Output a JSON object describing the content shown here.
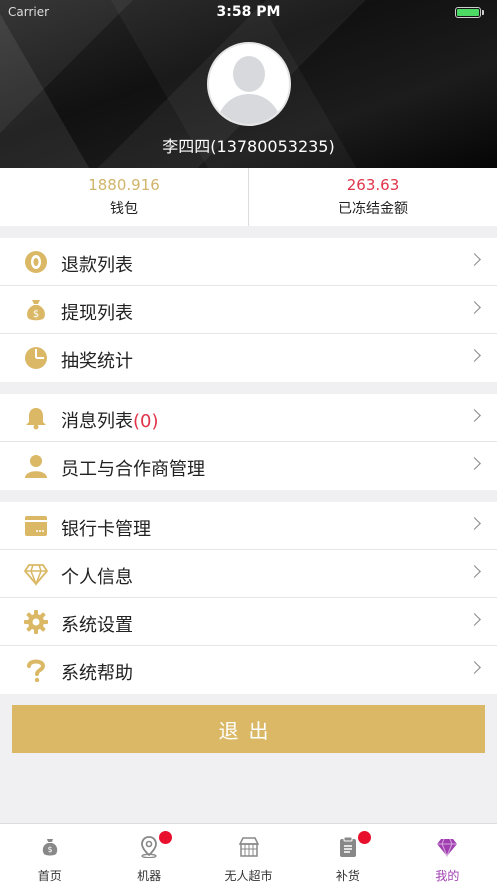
{
  "status_bar": {
    "carrier": "Carrier",
    "time": "3:58 PM"
  },
  "profile": {
    "name": "李四四(13780053235)"
  },
  "stats": [
    {
      "value": "1880.916",
      "label": "钱包",
      "color": "#d0b46a"
    },
    {
      "value": "263.63",
      "label": "已冻结金额",
      "color": "#e0344a"
    }
  ],
  "menu": {
    "group1": [
      {
        "label": "退款列表",
        "icon": "refund-icon"
      },
      {
        "label": "提现列表",
        "icon": "money-bag-icon"
      },
      {
        "label": "抽奖统计",
        "icon": "pie-chart-icon"
      }
    ],
    "group2": [
      {
        "label": "消息列表",
        "count": "(0)",
        "icon": "bell-icon"
      },
      {
        "label": "员工与合作商管理",
        "icon": "person-icon"
      }
    ],
    "group3": [
      {
        "label": "银行卡管理",
        "icon": "card-icon"
      },
      {
        "label": "个人信息",
        "icon": "diamond-icon"
      },
      {
        "label": "系统设置",
        "icon": "gear-icon"
      },
      {
        "label": "系统帮助",
        "icon": "question-icon"
      }
    ]
  },
  "logout_label": "退出",
  "tabs": [
    {
      "label": "首页",
      "icon": "home-icon",
      "badge": false,
      "active": false
    },
    {
      "label": "机器",
      "icon": "location-icon",
      "badge": true,
      "active": false
    },
    {
      "label": "无人超市",
      "icon": "store-icon",
      "badge": false,
      "active": false
    },
    {
      "label": "补货",
      "icon": "clipboard-icon",
      "badge": true,
      "active": false
    },
    {
      "label": "我的",
      "icon": "diamond-icon",
      "badge": false,
      "active": true
    }
  ],
  "colors": {
    "accent": "#dab866",
    "active_tab": "#a040b0",
    "badge": "#e8102c"
  }
}
